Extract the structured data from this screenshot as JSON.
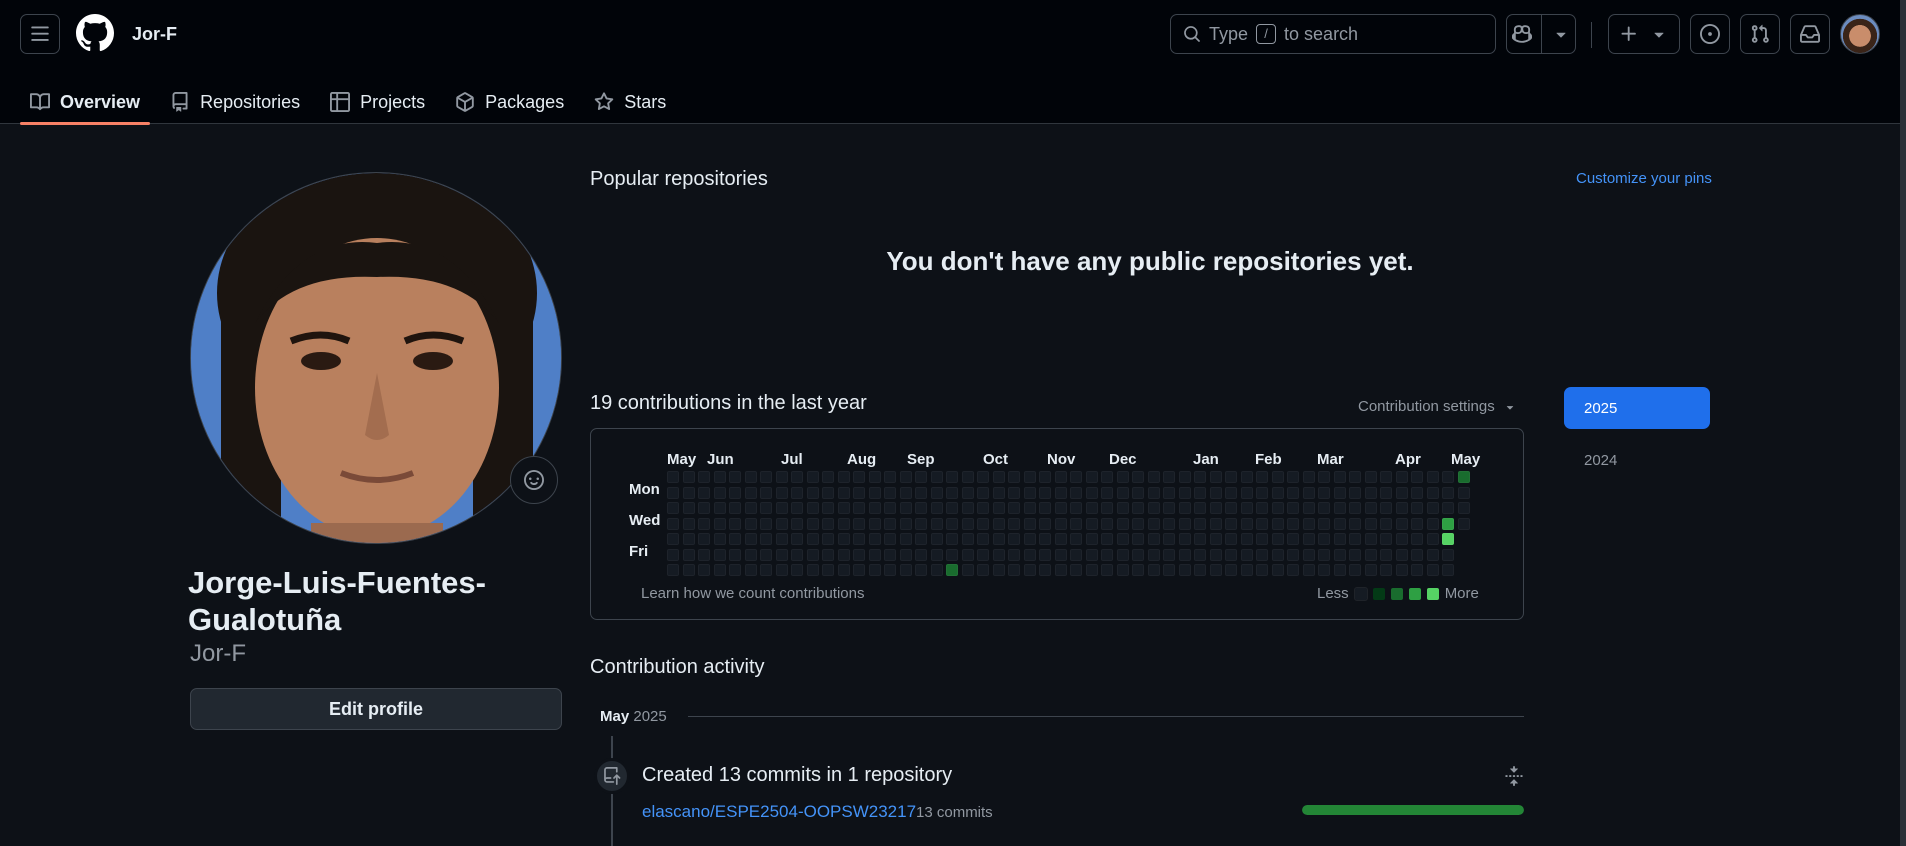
{
  "header": {
    "username": "Jor-F",
    "search": {
      "placeholder_before": "Type",
      "kbd": "/",
      "placeholder_after": "to search"
    },
    "icons": [
      "menu-icon",
      "github-logo",
      "search-icon",
      "copilot-icon",
      "plus-icon",
      "issues-icon",
      "pull-request-icon",
      "inbox-icon"
    ]
  },
  "tabs": [
    {
      "label": "Overview",
      "icon": "book-icon",
      "active": true
    },
    {
      "label": "Repositories",
      "icon": "repo-icon"
    },
    {
      "label": "Projects",
      "icon": "table-icon"
    },
    {
      "label": "Packages",
      "icon": "package-icon"
    },
    {
      "label": "Stars",
      "icon": "star-icon"
    }
  ],
  "profile": {
    "full_name": "Jorge-Luis-Fuentes-Gualotuña",
    "login": "Jor-F",
    "edit_button": "Edit profile"
  },
  "popular": {
    "title": "Popular repositories",
    "customize": "Customize your pins",
    "empty": "You don't have any public repositories yet."
  },
  "contributions": {
    "title": "19 contributions in the last year",
    "settings": "Contribution settings",
    "months": [
      "May",
      "Jun",
      "Jul",
      "Aug",
      "Sep",
      "Oct",
      "Nov",
      "Dec",
      "Jan",
      "Feb",
      "Mar",
      "Apr",
      "May"
    ],
    "days": [
      "Mon",
      "Wed",
      "Fri"
    ],
    "learn": "Learn how we count contributions",
    "legend_less": "Less",
    "legend_more": "More",
    "colors": [
      "#151b23",
      "#033a16",
      "#196c2e",
      "#2ea043",
      "#56d364"
    ],
    "active_cells": [
      {
        "week": 18,
        "day": 6,
        "level": 2
      },
      {
        "week": 50,
        "day": 3,
        "level": 3
      },
      {
        "week": 50,
        "day": 4,
        "level": 4
      },
      {
        "week": 51,
        "day": 0,
        "level": 2
      },
      {
        "week": 51,
        "day": 4,
        "level": 2
      }
    ],
    "weeks": 52,
    "last_week_days": 4
  },
  "years": {
    "selected": "2025",
    "other": "2024"
  },
  "activity": {
    "title": "Contribution activity",
    "month": "May",
    "year": "2025",
    "item_title": "Created 13 commits in 1 repository",
    "repo": "elascano/ESPE2504-OOPSW23217",
    "repo_commits": "13 commits",
    "progress_fraction": 1.0
  }
}
